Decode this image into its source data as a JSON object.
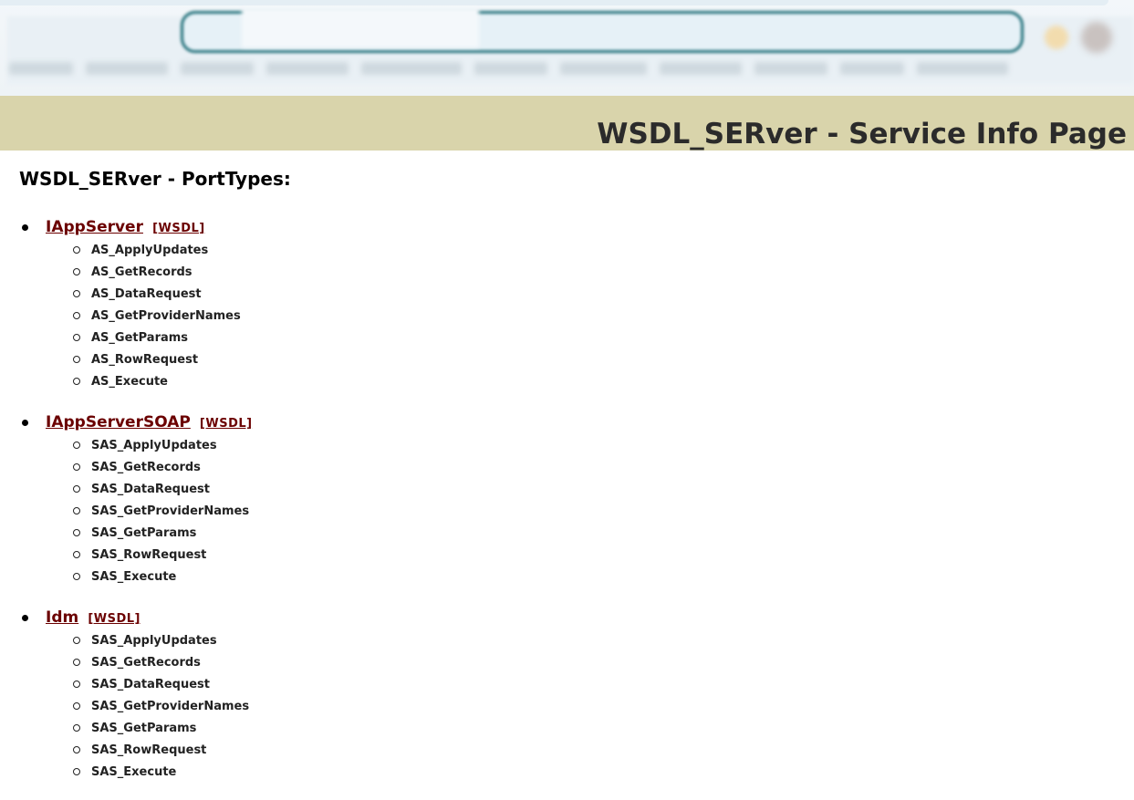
{
  "page_title": "WSDL_SERver - Service Info Page",
  "section_title": "WSDL_SERver - PortTypes:",
  "port_types": [
    {
      "name": "IAppServer",
      "wsdl_label": "[WSDL]",
      "operations": [
        "AS_ApplyUpdates",
        "AS_GetRecords",
        "AS_DataRequest",
        "AS_GetProviderNames",
        "AS_GetParams",
        "AS_RowRequest",
        "AS_Execute"
      ]
    },
    {
      "name": "IAppServerSOAP",
      "wsdl_label": "[WSDL]",
      "operations": [
        "SAS_ApplyUpdates",
        "SAS_GetRecords",
        "SAS_DataRequest",
        "SAS_GetProviderNames",
        "SAS_GetParams",
        "SAS_RowRequest",
        "SAS_Execute"
      ]
    },
    {
      "name": "Idm",
      "wsdl_label": "[WSDL]",
      "operations": [
        "SAS_ApplyUpdates",
        "SAS_GetRecords",
        "SAS_DataRequest",
        "SAS_GetProviderNames",
        "SAS_GetParams",
        "SAS_RowRequest",
        "SAS_Execute"
      ]
    }
  ],
  "colors": {
    "banner": "#d9d4ab",
    "link": "#6b0000",
    "address_bar_border": "#1e6e78"
  }
}
